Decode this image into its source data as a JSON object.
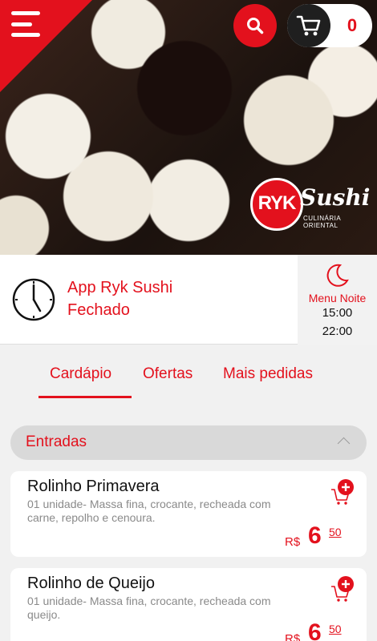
{
  "header": {
    "cart_count": "0",
    "logo_mark": "RYK",
    "logo_word": "Sushi",
    "logo_sub": "CULINÁRIA ORIENTAL",
    "icons": [
      "menu-icon",
      "search-icon",
      "cart-icon",
      "clock-icon",
      "moon-icon",
      "chevron-up-icon",
      "add-to-cart-icon"
    ]
  },
  "status": {
    "store_name": "App Ryk Sushi",
    "state": "Fechado",
    "menu_label": "Menu Noite",
    "open_time": "15:00",
    "close_time": "22:00"
  },
  "tabs": [
    {
      "label": "Cardápio",
      "active": true
    },
    {
      "label": "Ofertas",
      "active": false
    },
    {
      "label": "Mais pedidas",
      "active": false
    }
  ],
  "category": {
    "label": "Entradas"
  },
  "products": [
    {
      "name": "Rolinho Primavera",
      "description": "01 unidade- Massa fina, crocante, recheada com carne, repolho e cenoura.",
      "currency": "R$",
      "price_int": "6",
      "price_cents": "50"
    },
    {
      "name": "Rolinho de Queijo",
      "description": "01 unidade- Massa fina, crocante, recheada com queijo.",
      "currency": "R$",
      "price_int": "6",
      "price_cents": "50"
    }
  ],
  "colors": {
    "accent": "#e3111d",
    "dark": "#1f1f1f",
    "background": "#f1f1f1"
  }
}
